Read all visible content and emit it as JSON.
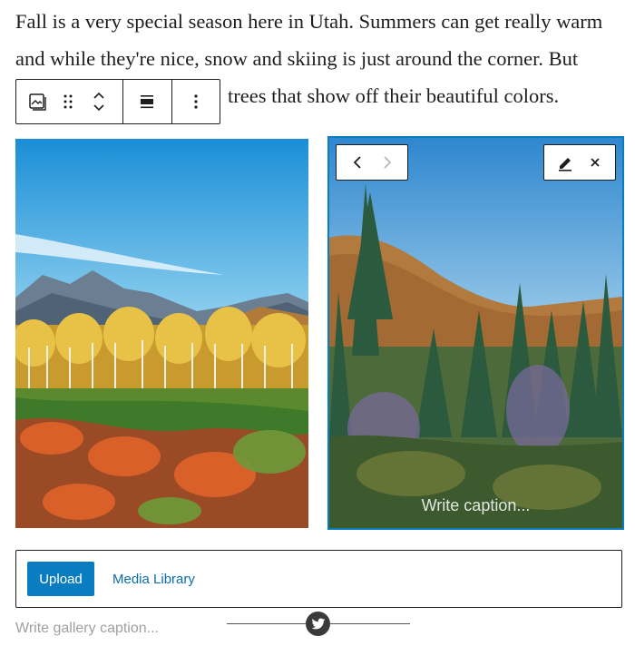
{
  "paragraph": {
    "line1": "Fall is a very special season here in Utah. Summers can get really warm",
    "line2": "and while they're nice, snow and skiing is just around the corner. But",
    "line3": "trees that show off their beautiful colors."
  },
  "block_toolbar": {
    "icons": [
      "gallery-icon",
      "drag-handle-icon",
      "move-up-down-icon",
      "align-icon",
      "more-options-icon"
    ]
  },
  "gallery": {
    "images": [
      {
        "alt": "Autumn aspens and mountains",
        "selected": false
      },
      {
        "alt": "Evergreen forest on hillside",
        "selected": true,
        "caption_placeholder": "Write caption..."
      }
    ],
    "image_toolbar": {
      "nav": [
        "chevron-left-icon",
        "chevron-right-icon"
      ],
      "actions": [
        "pencil-icon",
        "close-icon"
      ]
    },
    "upload_label": "Upload",
    "media_library_label": "Media Library",
    "caption_placeholder": "Write gallery caption..."
  },
  "embed": {
    "icon": "twitter-icon"
  },
  "colors": {
    "accent": "#0a7dc1",
    "text": "#1e1e1e",
    "placeholder": "#a0a0a0"
  }
}
